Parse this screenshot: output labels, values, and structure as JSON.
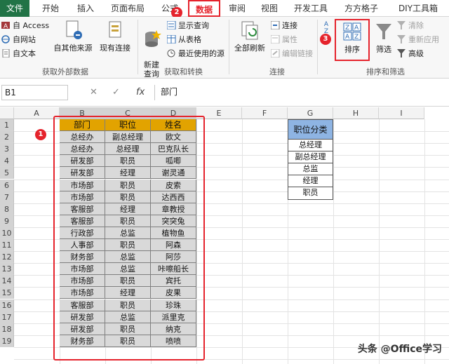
{
  "ribbon_tabs": [
    "文件",
    "开始",
    "插入",
    "页面布局",
    "公式",
    "数据",
    "审阅",
    "视图",
    "开发工具",
    "方方格子",
    "DIY工具箱"
  ],
  "ribbon": {
    "get_external": {
      "access": "自 Access",
      "web": "自网站",
      "text": "自文本",
      "other_sources": "自其他来源",
      "existing_connections": "现有连接",
      "label": "获取外部数据"
    },
    "get_transform": {
      "new_query": "新建\n查询",
      "show_queries": "显示查询",
      "from_table": "从表格",
      "recent_sources": "最近使用的源",
      "label": "获取和转换"
    },
    "connections": {
      "refresh_all": "全部刷新",
      "connections": "连接",
      "properties": "属性",
      "edit_links": "编辑链接",
      "label": "连接"
    },
    "sort_filter": {
      "sort": "排序",
      "filter": "筛选",
      "clear": "清除",
      "reapply": "重新应用",
      "advanced": "高级",
      "label": "排序和筛选"
    }
  },
  "badges": [
    "1",
    "2",
    "3"
  ],
  "formula_bar": {
    "name_box": "B1",
    "fx": "fx",
    "value": "部门"
  },
  "columns": [
    "A",
    "B",
    "C",
    "D",
    "E",
    "F",
    "G",
    "H",
    "I"
  ],
  "rows": [
    "1",
    "2",
    "3",
    "4",
    "5",
    "6",
    "7",
    "8",
    "9",
    "10",
    "11",
    "12",
    "13",
    "14",
    "15",
    "16",
    "17",
    "18",
    "19"
  ],
  "table": {
    "headers": [
      "部门",
      "职位",
      "姓名"
    ],
    "rows": [
      [
        "总经办",
        "副总经理",
        "欧文"
      ],
      [
        "总经办",
        "总经理",
        "巴克队长"
      ],
      [
        "研发部",
        "职员",
        "呱唧"
      ],
      [
        "研发部",
        "经理",
        "谢灵通"
      ],
      [
        "市场部",
        "职员",
        "皮索"
      ],
      [
        "市场部",
        "职员",
        "达西西"
      ],
      [
        "客服部",
        "经理",
        "章教授"
      ],
      [
        "客服部",
        "职员",
        "突突兔"
      ],
      [
        "行政部",
        "总监",
        "植物鱼"
      ],
      [
        "人事部",
        "职员",
        "阿森"
      ],
      [
        "财务部",
        "总监",
        "阿莎"
      ],
      [
        "市场部",
        "总监",
        "咔嚓船长"
      ],
      [
        "市场部",
        "职员",
        "宾托"
      ],
      [
        "市场部",
        "经理",
        "皮果"
      ],
      [
        "客服部",
        "职员",
        "珍珠"
      ],
      [
        "研发部",
        "总监",
        "派里克"
      ],
      [
        "研发部",
        "职员",
        "纳克"
      ],
      [
        "财务部",
        "职员",
        "喷喷"
      ]
    ]
  },
  "category": {
    "header": "职位分类",
    "items": [
      "总经理",
      "副总经理",
      "总监",
      "经理",
      "职员"
    ]
  },
  "watermark": "头条 @Office学习",
  "colors": {
    "excel_green": "#217346",
    "highlight_red": "#e5232c",
    "header_gold": "#e2a300",
    "category_blue": "#8eb4e3",
    "data_gray": "#d9d9d9"
  }
}
